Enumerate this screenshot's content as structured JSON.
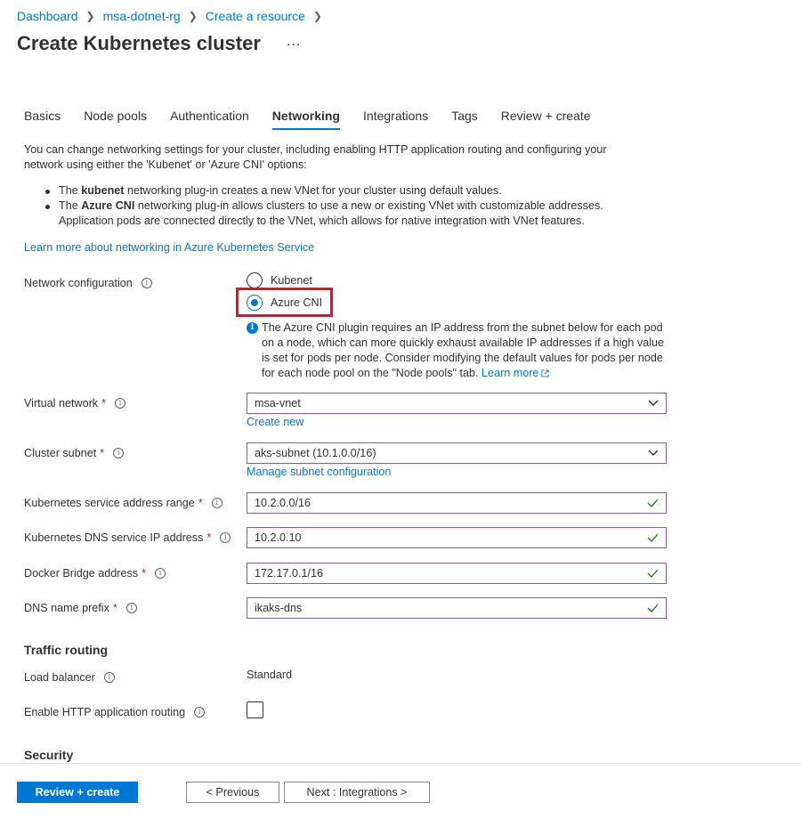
{
  "breadcrumb": [
    "Dashboard",
    "msa-dotnet-rg",
    "Create a resource"
  ],
  "page_title": "Create Kubernetes cluster",
  "more_label": "...",
  "tabs": [
    {
      "label": "Basics",
      "active": false
    },
    {
      "label": "Node pools",
      "active": false
    },
    {
      "label": "Authentication",
      "active": false
    },
    {
      "label": "Networking",
      "active": true
    },
    {
      "label": "Integrations",
      "active": false
    },
    {
      "label": "Tags",
      "active": false
    },
    {
      "label": "Review + create",
      "active": false
    }
  ],
  "intro": "You can change networking settings for your cluster, including enabling HTTP application routing and configuring your network using either the 'Kubenet' or 'Azure CNI' options:",
  "bullets": {
    "b1_prefix": "The ",
    "b1_bold": "kubenet",
    "b1_rest": " networking plug-in creates a new VNet for your cluster using default values.",
    "b2_prefix": "The ",
    "b2_bold": "Azure CNI",
    "b2_rest": " networking plug-in allows clusters to use a new or existing VNet with customizable addresses. Application pods are connected directly to the VNet, which allows for native integration with VNet features."
  },
  "learn_more_networking": "Learn more about networking in Azure Kubernetes Service",
  "network_config": {
    "label": "Network configuration",
    "options": [
      "Kubenet",
      "Azure CNI"
    ],
    "selected": "Azure CNI",
    "note": "The Azure CNI plugin requires an IP address from the subnet below for each pod on a node, which can more quickly exhaust available IP addresses if a high value is set for pods per node. Consider modifying the default values for pods per node for each node pool on the \"Node pools\" tab.",
    "note_link": "Learn more"
  },
  "fields": {
    "vnet": {
      "label": "Virtual network",
      "value": "msa-vnet",
      "link": "Create new"
    },
    "subnet": {
      "label": "Cluster subnet",
      "value": "aks-subnet (10.1.0.0/16)",
      "link": "Manage subnet configuration"
    },
    "svc_range": {
      "label": "Kubernetes service address range",
      "value": "10.2.0.0/16"
    },
    "dns_ip": {
      "label": "Kubernetes DNS service IP address",
      "value": "10.2.0.10"
    },
    "docker_bridge": {
      "label": "Docker Bridge address",
      "value": "172.17.0.1/16"
    },
    "dns_prefix": {
      "label": "DNS name prefix",
      "value": "ikaks-dns"
    }
  },
  "required_mark": "*",
  "info_glyph": "i",
  "traffic": {
    "heading": "Traffic routing",
    "lb_label": "Load balancer",
    "lb_value": "Standard",
    "http_label": "Enable HTTP application routing",
    "http_checked": false
  },
  "security_heading": "Security",
  "footer": {
    "review": "Review + create",
    "previous": "< Previous",
    "next": "Next : Integrations >"
  },
  "colors": {
    "accent": "#0078d4",
    "highlight": "#e81123",
    "valid": "#107c10",
    "required": "#a4262c"
  }
}
